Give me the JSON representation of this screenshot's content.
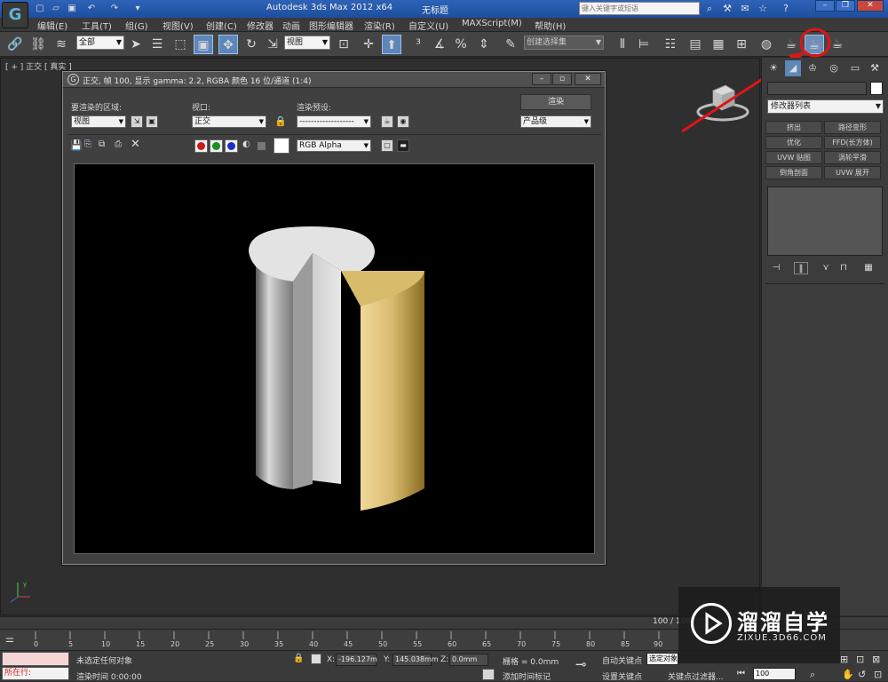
{
  "titlebar": {
    "app_title": "Autodesk 3ds Max  2012 x64",
    "doc_title": "无标题",
    "search_placeholder": "键入关键字或短语",
    "logo_letter": "G"
  },
  "menu": [
    "编辑(E)",
    "工具(T)",
    "组(G)",
    "视图(V)",
    "创建(C)",
    "修改器",
    "动画",
    "图形编辑器",
    "渲染(R)",
    "自定义(U)",
    "MAXScript(M)",
    "帮助(H)"
  ],
  "toolbar": {
    "selection_filter": "全部",
    "ref_coord": "视图",
    "named_selection": "创建选择集"
  },
  "viewport": {
    "label": "[ + ] 正交 [ 真实 ]"
  },
  "render_window": {
    "title": "正交, 帧 100, 显示 gamma: 2.2, RGBA 颜色 16 位/通道 (1:4)",
    "area_label": "要渲染的区域:",
    "area_value": "视图",
    "viewport_label": "视口:",
    "viewport_value": "正交",
    "preset_label": "渲染预设:",
    "preset_value": "-------------------",
    "render_button": "渲染",
    "quality_value": "产品级",
    "channel_value": "RGB Alpha"
  },
  "command_panel": {
    "modifier_list": "修改器列表",
    "modifier_buttons": [
      "挤出",
      "路径变形",
      "优化",
      "FFD(长方体)",
      "UVW 贴图",
      "涡轮平滑",
      "倒角剖面",
      "UVW 展开"
    ]
  },
  "timeline": {
    "slider": "100 / 100",
    "ticks": [
      "0",
      "5",
      "10",
      "15",
      "20",
      "25",
      "30",
      "35",
      "40",
      "45",
      "50",
      "55",
      "60",
      "65",
      "70",
      "75",
      "80",
      "85",
      "90"
    ]
  },
  "status": {
    "running": "所在行:",
    "selection": "未选定任何对象",
    "render_time": "渲染时间  0:00:00",
    "x_label": "X:",
    "x_value": "-196.127m",
    "y_label": "Y:",
    "y_value": "145.038mm",
    "z_label": "Z:",
    "z_value": "0.0mm",
    "grid": "栅格 = 0.0mm",
    "add_time_tag": "添加时间标记",
    "auto_key": "自动关键点",
    "selected_obj": "选定对象",
    "set_key": "设置关键点",
    "key_filter": "关键点过滤器...",
    "frame": "100"
  },
  "watermark": {
    "title": "溜溜自学",
    "subtitle": "ZIXUE.3D66.COM"
  },
  "colors": {
    "annotation_red": "#e01515",
    "render_bg": "#000000",
    "cylinder_gray": "#c8c8c8",
    "wedge_gold": "#d9bb6e"
  }
}
